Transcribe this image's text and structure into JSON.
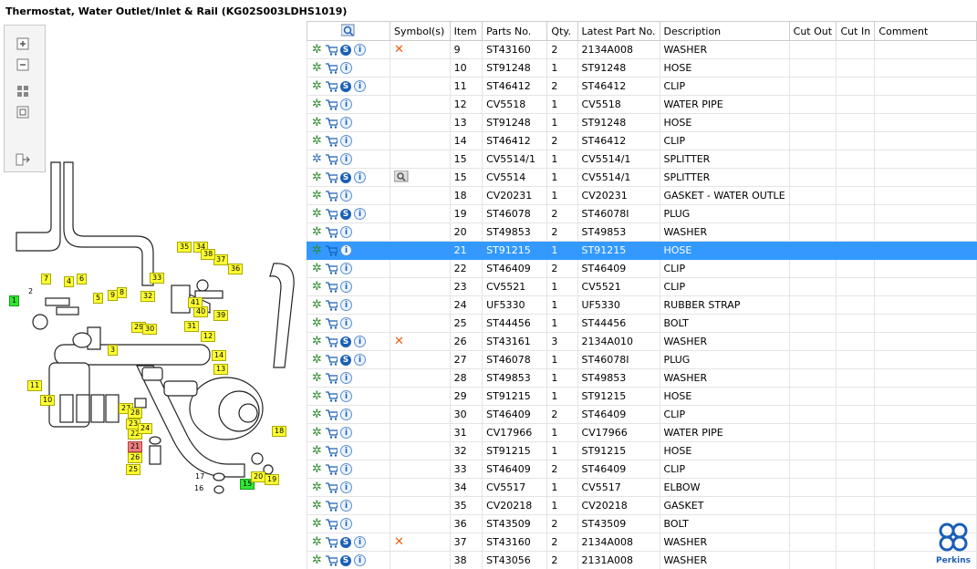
{
  "title": "Thermostat, Water Outlet/Inlet & Rail (KG02S003LDHS1019)",
  "columns": [
    "",
    "Symbol(s)",
    "Item",
    "Parts No.",
    "Qty.",
    "Latest Part No.",
    "Description",
    "Cut Out",
    "Cut In",
    "Comment"
  ],
  "rows": [
    {
      "icons": [
        "gear",
        "cart",
        "s",
        "i"
      ],
      "symbol": "x",
      "item": "9",
      "part": "ST43160",
      "qty": "2",
      "latest": "2134A008",
      "desc": "WASHER"
    },
    {
      "icons": [
        "gear",
        "cart",
        "i"
      ],
      "symbol": "",
      "item": "10",
      "part": "ST91248",
      "qty": "1",
      "latest": "ST91248",
      "desc": "HOSE"
    },
    {
      "icons": [
        "gear",
        "cart",
        "s",
        "i"
      ],
      "symbol": "",
      "item": "11",
      "part": "ST46412",
      "qty": "2",
      "latest": "ST46412",
      "desc": "CLIP"
    },
    {
      "icons": [
        "gear",
        "cart",
        "i"
      ],
      "symbol": "",
      "item": "12",
      "part": "CV5518",
      "qty": "1",
      "latest": "CV5518",
      "desc": "WATER PIPE"
    },
    {
      "icons": [
        "gear",
        "cart",
        "i"
      ],
      "symbol": "",
      "item": "13",
      "part": "ST91248",
      "qty": "1",
      "latest": "ST91248",
      "desc": "HOSE"
    },
    {
      "icons": [
        "gear",
        "cart",
        "i"
      ],
      "symbol": "",
      "item": "14",
      "part": "ST46412",
      "qty": "2",
      "latest": "ST46412",
      "desc": "CLIP"
    },
    {
      "icons": [
        "gears",
        "cart",
        "i"
      ],
      "symbol": "",
      "item": "15",
      "part": "CV5514/1",
      "qty": "1",
      "latest": "CV5514/1",
      "desc": "SPLITTER"
    },
    {
      "icons": [
        "gear",
        "cart",
        "s",
        "i"
      ],
      "symbol": "mag",
      "item": "15",
      "part": "CV5514",
      "qty": "1",
      "latest": "CV5514/1",
      "desc": "SPLITTER"
    },
    {
      "icons": [
        "gear",
        "cart",
        "i"
      ],
      "symbol": "",
      "item": "18",
      "part": "CV20231",
      "qty": "1",
      "latest": "CV20231",
      "desc": "GASKET - WATER OUTLE"
    },
    {
      "icons": [
        "gear",
        "cart",
        "s",
        "i"
      ],
      "symbol": "",
      "item": "19",
      "part": "ST46078",
      "qty": "2",
      "latest": "ST46078I",
      "desc": "PLUG"
    },
    {
      "icons": [
        "gear",
        "cart",
        "i"
      ],
      "symbol": "",
      "item": "20",
      "part": "ST49853",
      "qty": "2",
      "latest": "ST49853",
      "desc": "WASHER"
    },
    {
      "icons": [
        "gear",
        "cart",
        "i"
      ],
      "symbol": "",
      "item": "21",
      "part": "ST91215",
      "qty": "1",
      "latest": "ST91215",
      "desc": "HOSE",
      "selected": true
    },
    {
      "icons": [
        "gear",
        "cart",
        "i"
      ],
      "symbol": "",
      "item": "22",
      "part": "ST46409",
      "qty": "2",
      "latest": "ST46409",
      "desc": "CLIP"
    },
    {
      "icons": [
        "gear",
        "cart",
        "i"
      ],
      "symbol": "",
      "item": "23",
      "part": "CV5521",
      "qty": "1",
      "latest": "CV5521",
      "desc": "CLIP"
    },
    {
      "icons": [
        "gear",
        "cart",
        "i"
      ],
      "symbol": "",
      "item": "24",
      "part": "UF5330",
      "qty": "1",
      "latest": "UF5330",
      "desc": "RUBBER STRAP"
    },
    {
      "icons": [
        "gear",
        "cart",
        "i"
      ],
      "symbol": "",
      "item": "25",
      "part": "ST44456",
      "qty": "1",
      "latest": "ST44456",
      "desc": "BOLT"
    },
    {
      "icons": [
        "gear",
        "cart",
        "s",
        "i"
      ],
      "symbol": "x",
      "item": "26",
      "part": "ST43161",
      "qty": "3",
      "latest": "2134A010",
      "desc": "WASHER"
    },
    {
      "icons": [
        "gear",
        "cart",
        "s",
        "i"
      ],
      "symbol": "",
      "item": "27",
      "part": "ST46078",
      "qty": "1",
      "latest": "ST46078I",
      "desc": "PLUG"
    },
    {
      "icons": [
        "gear",
        "cart",
        "i"
      ],
      "symbol": "",
      "item": "28",
      "part": "ST49853",
      "qty": "1",
      "latest": "ST49853",
      "desc": "WASHER"
    },
    {
      "icons": [
        "gear",
        "cart",
        "i"
      ],
      "symbol": "",
      "item": "29",
      "part": "ST91215",
      "qty": "1",
      "latest": "ST91215",
      "desc": "HOSE"
    },
    {
      "icons": [
        "gear",
        "cart",
        "i"
      ],
      "symbol": "",
      "item": "30",
      "part": "ST46409",
      "qty": "2",
      "latest": "ST46409",
      "desc": "CLIP"
    },
    {
      "icons": [
        "gear",
        "cart",
        "i"
      ],
      "symbol": "",
      "item": "31",
      "part": "CV17966",
      "qty": "1",
      "latest": "CV17966",
      "desc": "WATER PIPE"
    },
    {
      "icons": [
        "gear",
        "cart",
        "i"
      ],
      "symbol": "",
      "item": "32",
      "part": "ST91215",
      "qty": "1",
      "latest": "ST91215",
      "desc": "HOSE"
    },
    {
      "icons": [
        "gear",
        "cart",
        "i"
      ],
      "symbol": "",
      "item": "33",
      "part": "ST46409",
      "qty": "2",
      "latest": "ST46409",
      "desc": "CLIP"
    },
    {
      "icons": [
        "gear",
        "cart",
        "i"
      ],
      "symbol": "",
      "item": "34",
      "part": "CV5517",
      "qty": "1",
      "latest": "CV5517",
      "desc": "ELBOW"
    },
    {
      "icons": [
        "gear",
        "cart",
        "i"
      ],
      "symbol": "",
      "item": "35",
      "part": "CV20218",
      "qty": "1",
      "latest": "CV20218",
      "desc": "GASKET"
    },
    {
      "icons": [
        "gear",
        "cart",
        "i"
      ],
      "symbol": "",
      "item": "36",
      "part": "ST43509",
      "qty": "2",
      "latest": "ST43509",
      "desc": "BOLT"
    },
    {
      "icons": [
        "gear",
        "cart",
        "s",
        "i"
      ],
      "symbol": "x",
      "item": "37",
      "part": "ST43160",
      "qty": "2",
      "latest": "2134A008",
      "desc": "WASHER"
    },
    {
      "icons": [
        "gear",
        "cart",
        "s",
        "i"
      ],
      "symbol": "",
      "item": "38",
      "part": "ST43056",
      "qty": "2",
      "latest": "2131A008",
      "desc": "WASHER"
    }
  ],
  "callouts": [
    {
      "t": "1",
      "c": "g"
    },
    {
      "t": "2",
      "c": "n"
    },
    {
      "t": "3",
      "c": "y"
    },
    {
      "t": "4",
      "c": "y"
    },
    {
      "t": "5",
      "c": "y"
    },
    {
      "t": "6",
      "c": "y"
    },
    {
      "t": "7",
      "c": "y"
    },
    {
      "t": "8",
      "c": "y"
    },
    {
      "t": "9",
      "c": "y"
    },
    {
      "t": "10",
      "c": "y"
    },
    {
      "t": "11",
      "c": "y"
    },
    {
      "t": "12",
      "c": "y"
    },
    {
      "t": "13",
      "c": "y"
    },
    {
      "t": "14",
      "c": "y"
    },
    {
      "t": "15",
      "c": "g"
    },
    {
      "t": "16",
      "c": "n"
    },
    {
      "t": "17",
      "c": "n"
    },
    {
      "t": "18",
      "c": "y"
    },
    {
      "t": "19",
      "c": "y"
    },
    {
      "t": "20",
      "c": "y"
    },
    {
      "t": "21",
      "c": "r"
    },
    {
      "t": "22",
      "c": "y"
    },
    {
      "t": "23",
      "c": "y"
    },
    {
      "t": "24",
      "c": "y"
    },
    {
      "t": "25",
      "c": "y"
    },
    {
      "t": "26",
      "c": "y"
    },
    {
      "t": "27",
      "c": "y"
    },
    {
      "t": "28",
      "c": "y"
    },
    {
      "t": "29",
      "c": "y"
    },
    {
      "t": "30",
      "c": "y"
    },
    {
      "t": "31",
      "c": "y"
    },
    {
      "t": "32",
      "c": "y"
    },
    {
      "t": "33",
      "c": "y"
    },
    {
      "t": "34",
      "c": "y"
    },
    {
      "t": "35",
      "c": "y"
    },
    {
      "t": "36",
      "c": "y"
    },
    {
      "t": "37",
      "c": "y"
    },
    {
      "t": "38",
      "c": "y"
    },
    {
      "t": "39",
      "c": "y"
    },
    {
      "t": "40",
      "c": "y"
    },
    {
      "t": "41",
      "c": "y"
    }
  ],
  "logo": {
    "text": "Perkins"
  },
  "icons": {
    "header_search": "search-icon",
    "zoom_in": "zoom-in-icon",
    "zoom_out": "zoom-out-icon",
    "fit": "fit-icon",
    "actual": "actual-size-icon",
    "export": "export-icon"
  }
}
